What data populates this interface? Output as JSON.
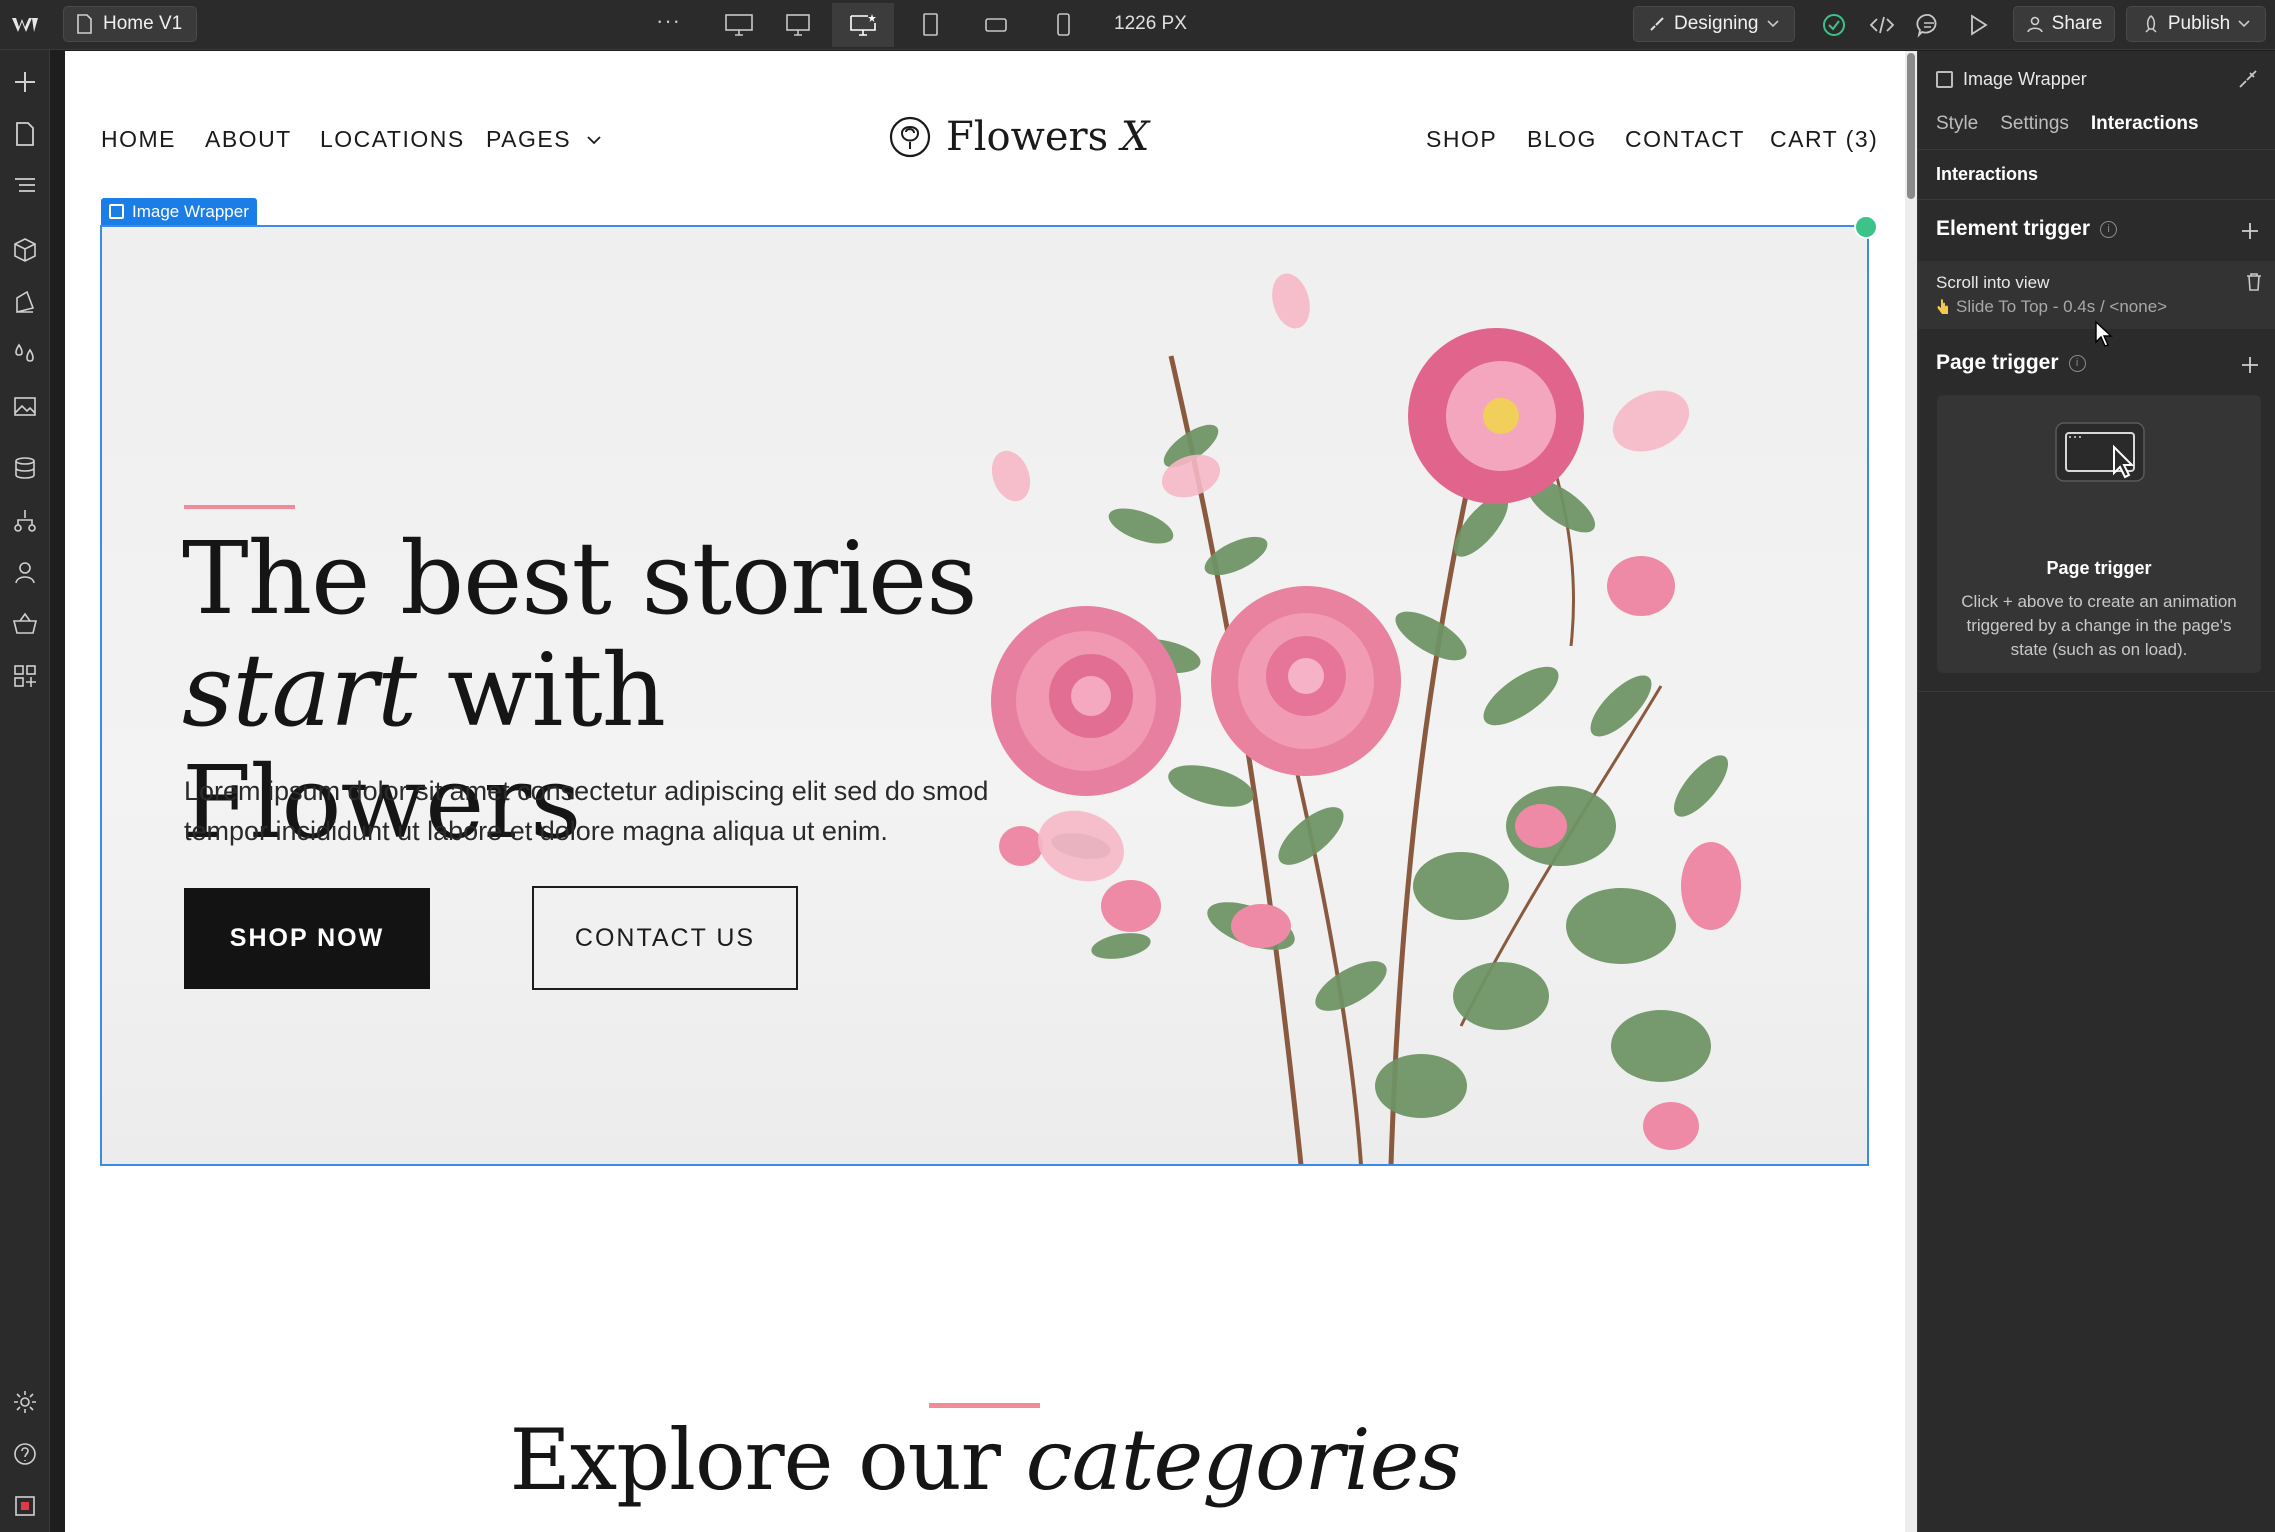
{
  "topbar": {
    "page_name": "Home V1",
    "more": "···",
    "width_readout": "1226 PX",
    "mode": "Designing",
    "share": "Share",
    "publish": "Publish"
  },
  "site": {
    "nav_left": [
      "HOME",
      "ABOUT",
      "LOCATIONS",
      "PAGES"
    ],
    "brand": "Flowers",
    "brand_mark": "X",
    "nav_right": [
      "SHOP",
      "BLOG",
      "CONTACT",
      "CART (3)"
    ]
  },
  "selection": {
    "label": "Image Wrapper"
  },
  "hero": {
    "title_line1": "The best stories",
    "title_line2_em": "start",
    "title_line2_rest": " with Flowers",
    "body": "Lorem ipsum dolor sit amet consectetur adipiscing elit sed do smod tempor incididunt ut labore et dolore magna aliqua ut enim.",
    "cta_primary": "SHOP NOW",
    "cta_secondary": "CONTACT US"
  },
  "categories": {
    "title_plain": "Explore our ",
    "title_em": "categories"
  },
  "panel": {
    "element": "Image Wrapper",
    "tabs": [
      "Style",
      "Settings",
      "Interactions"
    ],
    "active_tab": "Interactions",
    "section": "Interactions",
    "element_trigger": {
      "label": "Element trigger",
      "trigger": "Scroll into view",
      "detail": "Slide To Top - 0.4s / <none>"
    },
    "page_trigger": {
      "label": "Page trigger",
      "card_title": "Page trigger",
      "card_desc": "Click + above to create an animation triggered by a change in the page's state (such as on load)."
    }
  },
  "colors": {
    "accent_pink": "#ef8c98",
    "selection_blue": "#1a7ee6",
    "interaction_green": "#3cc38a",
    "ui_dark": "#2b2b2b"
  }
}
